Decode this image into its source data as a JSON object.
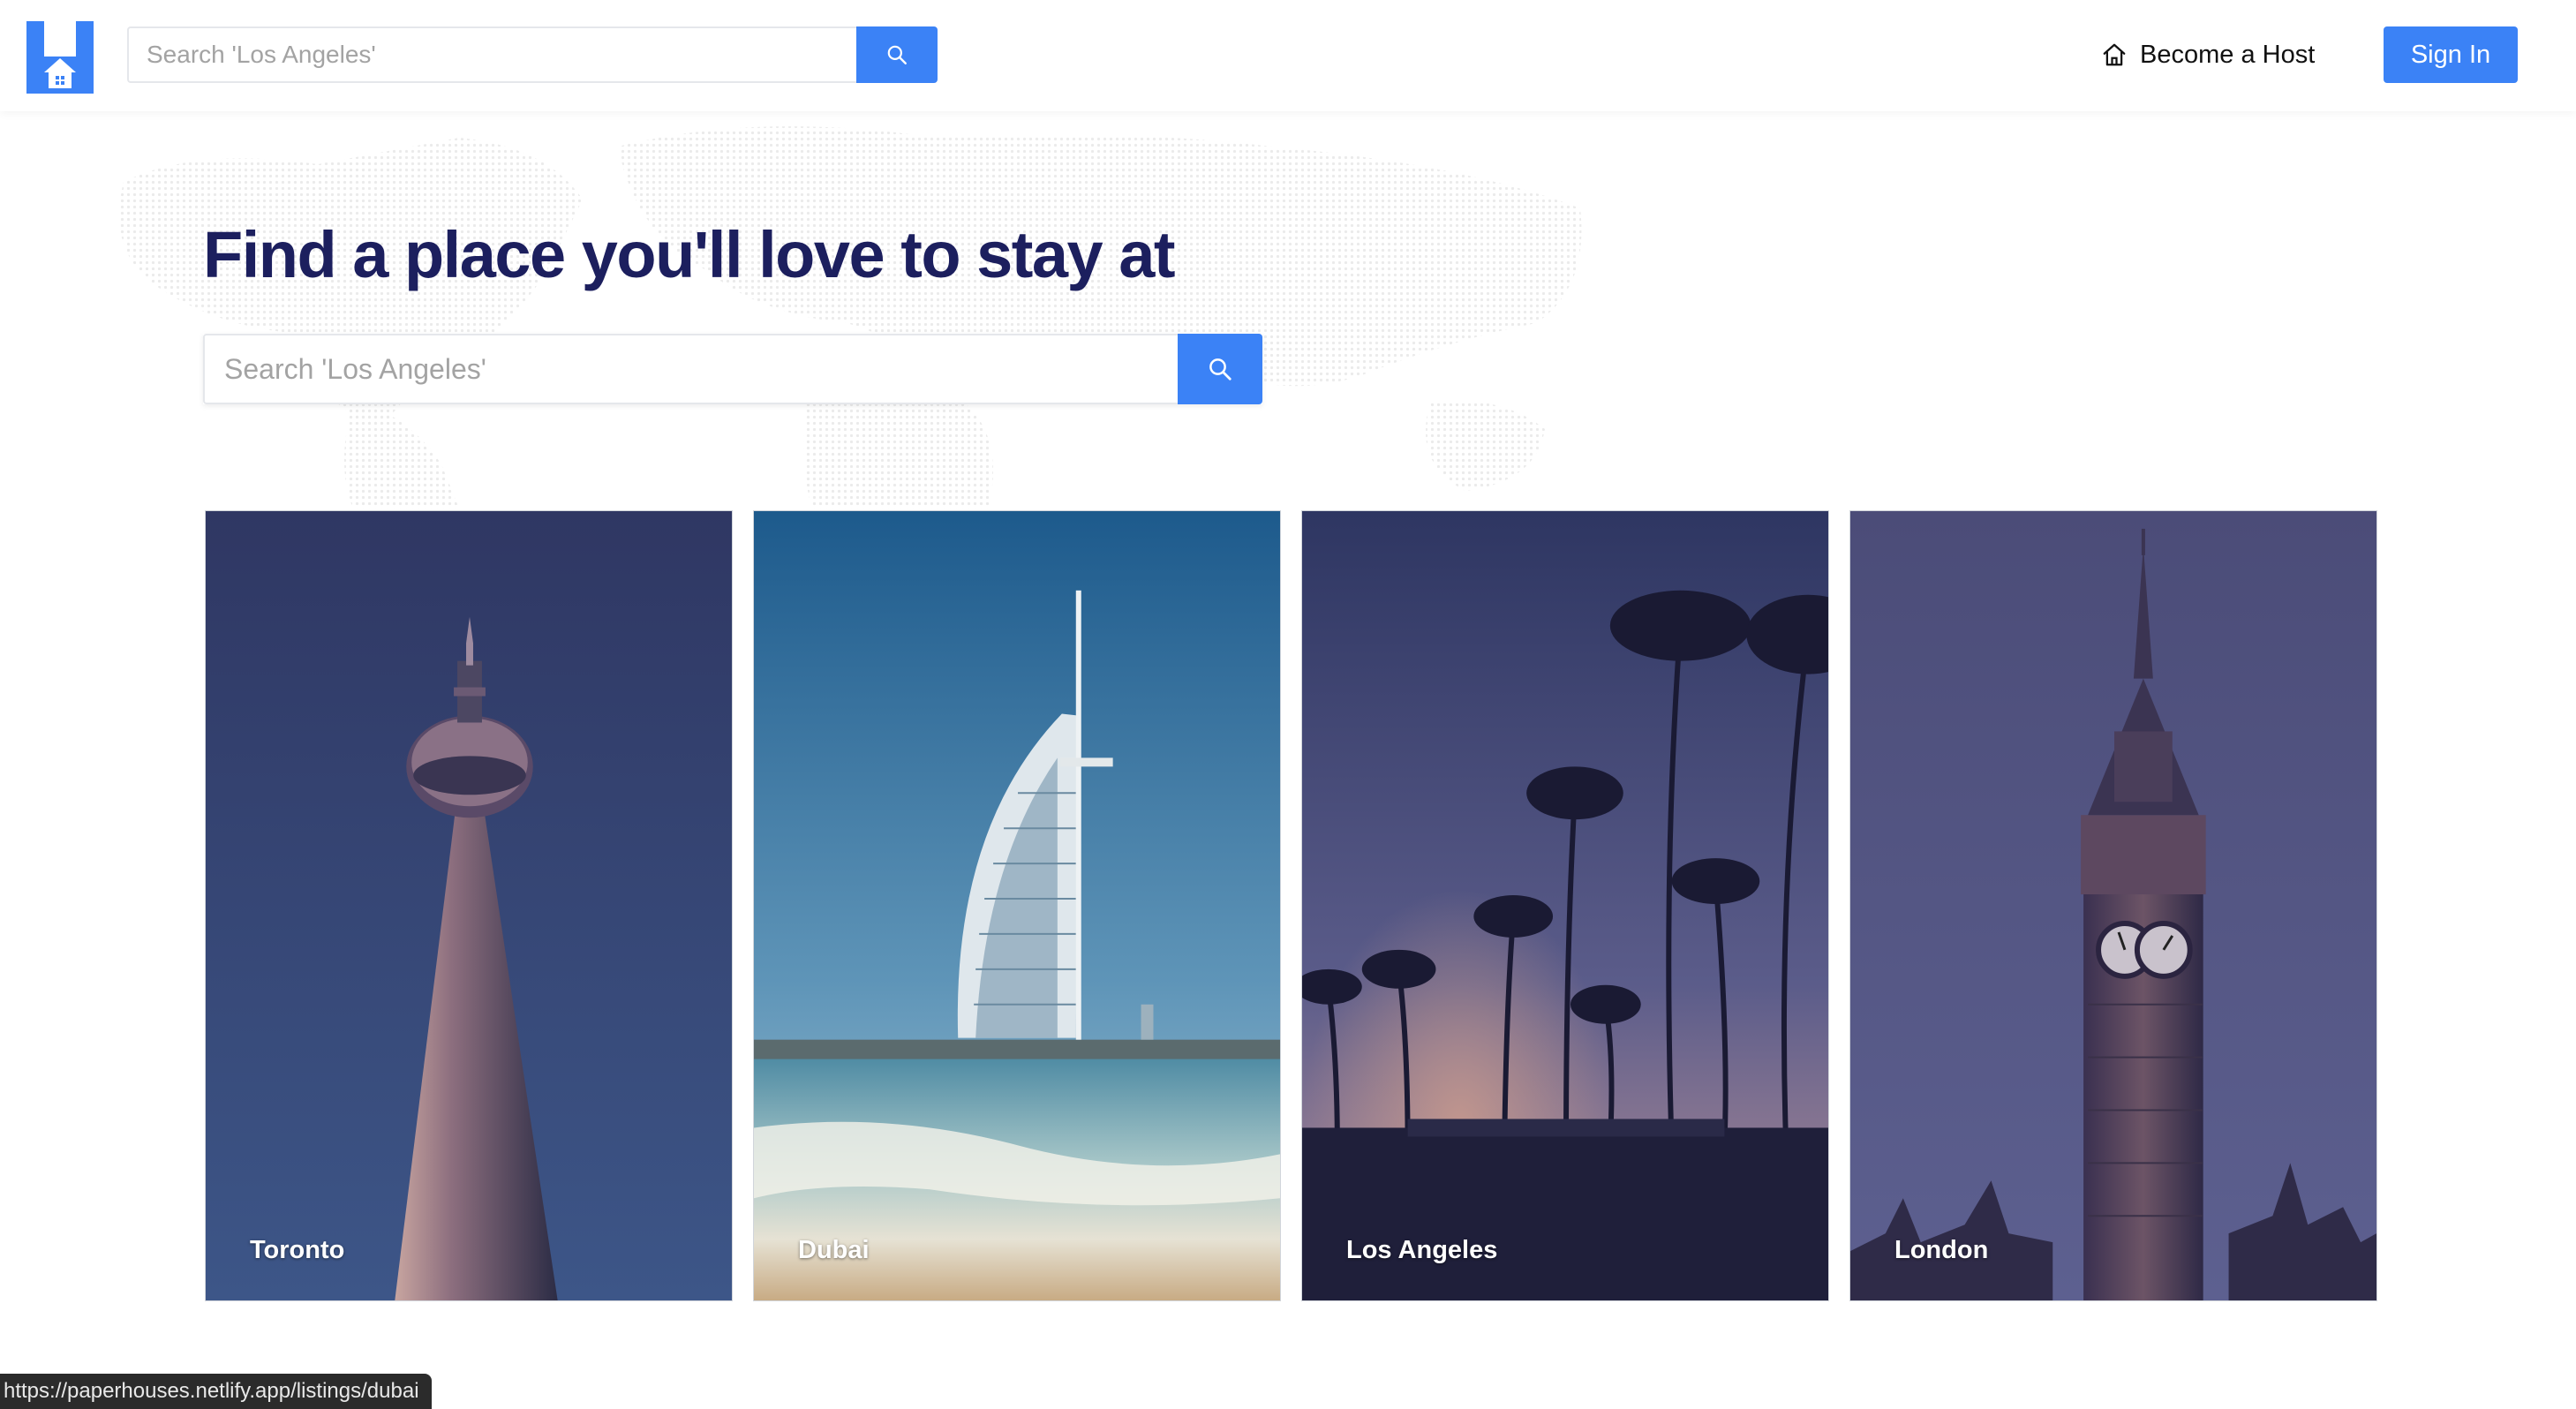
{
  "header": {
    "search_placeholder": "Search 'Los Angeles'",
    "become_host_label": "Become a Host",
    "sign_in_label": "Sign In"
  },
  "hero": {
    "title": "Find a place you'll love to stay at",
    "search_placeholder": "Search 'Los Angeles'"
  },
  "cities": [
    {
      "name": "Toronto"
    },
    {
      "name": "Dubai"
    },
    {
      "name": "Los Angeles"
    },
    {
      "name": "London"
    }
  ],
  "status_bar": {
    "url": "https://paperhouses.netlify.app/listings/dubai"
  },
  "colors": {
    "accent": "#3b82f6",
    "title": "#1c1f5e"
  },
  "icons": [
    "logo-icon",
    "search-icon",
    "house-icon"
  ]
}
